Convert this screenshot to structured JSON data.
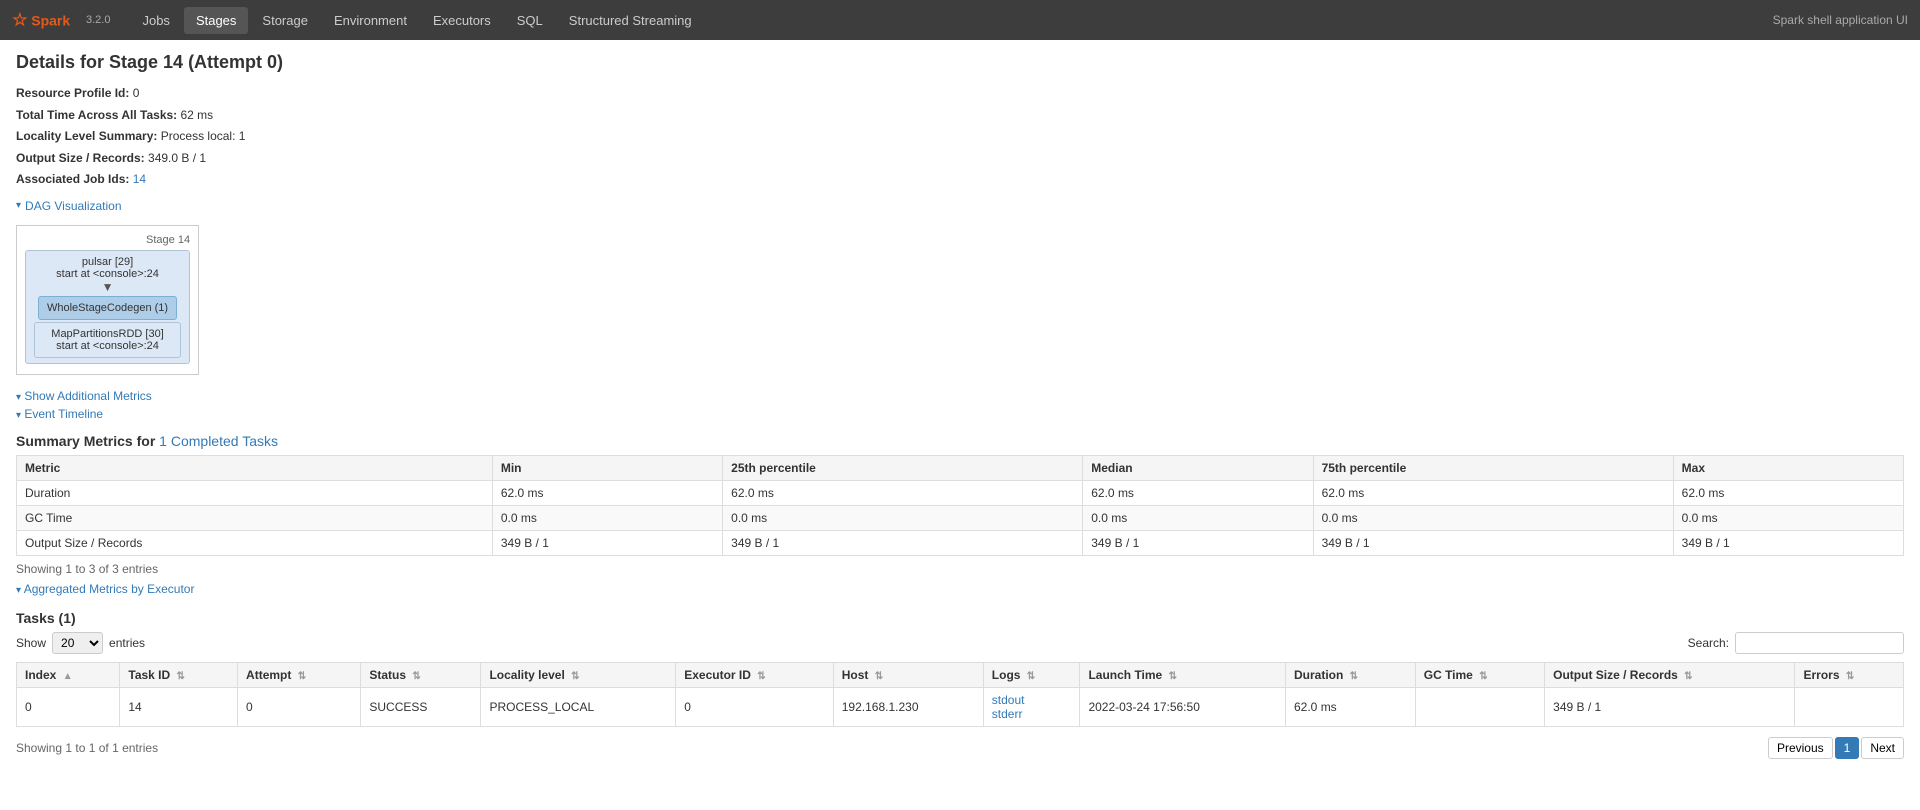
{
  "app": {
    "version": "3.2.0",
    "title": "Spark shell application UI"
  },
  "nav": {
    "items": [
      {
        "label": "Jobs",
        "href": "#",
        "active": false
      },
      {
        "label": "Stages",
        "href": "#",
        "active": true
      },
      {
        "label": "Storage",
        "href": "#",
        "active": false
      },
      {
        "label": "Environment",
        "href": "#",
        "active": false
      },
      {
        "label": "Executors",
        "href": "#",
        "active": false
      },
      {
        "label": "SQL",
        "href": "#",
        "active": false
      },
      {
        "label": "Structured Streaming",
        "href": "#",
        "active": false
      }
    ]
  },
  "page": {
    "title": "Details for Stage 14 (Attempt 0)",
    "resource_profile_id": "0",
    "total_time": "62 ms",
    "locality_level_summary": "Process local: 1",
    "output_size_records": "349.0 B / 1",
    "associated_job_ids": "14"
  },
  "dag": {
    "toggle_label": "DAG Visualization",
    "stage_label": "Stage 14",
    "outer_node_line1": "pulsar [29]",
    "outer_node_line2": "start at <console>:24",
    "inner_node": "WholeStageCodegen (1)",
    "sub_node_line1": "MapPartitionsRDD [30]",
    "sub_node_line2": "start at <console>:24"
  },
  "show_additional_metrics": "Show Additional Metrics",
  "event_timeline": "Event Timeline",
  "summary": {
    "header_prefix": "Summary Metrics for ",
    "completed_tasks_link": "1 Completed Tasks",
    "columns": [
      "Metric",
      "Min",
      "25th percentile",
      "Median",
      "75th percentile",
      "Max"
    ],
    "rows": [
      {
        "metric": "Duration",
        "min": "62.0 ms",
        "p25": "62.0 ms",
        "median": "62.0 ms",
        "p75": "62.0 ms",
        "max": "62.0 ms"
      },
      {
        "metric": "GC Time",
        "min": "0.0 ms",
        "p25": "0.0 ms",
        "median": "0.0 ms",
        "p75": "0.0 ms",
        "max": "0.0 ms"
      },
      {
        "metric": "Output Size / Records",
        "min": "349 B / 1",
        "p25": "349 B / 1",
        "median": "349 B / 1",
        "p75": "349 B / 1",
        "max": "349 B / 1"
      }
    ],
    "showing_text": "Showing 1 to 3 of 3 entries"
  },
  "aggregated_metrics": {
    "label": "Aggregated Metrics by Executor"
  },
  "tasks": {
    "header": "Tasks (1)",
    "show_label": "Show",
    "entries_label": "entries",
    "show_value": "20",
    "search_label": "Search:",
    "columns": [
      "Index",
      "Task ID",
      "Attempt",
      "Status",
      "Locality level",
      "Executor ID",
      "Host",
      "Logs",
      "Launch Time",
      "Duration",
      "GC Time",
      "Output Size / Records",
      "Errors"
    ],
    "rows": [
      {
        "index": "0",
        "task_id": "14",
        "attempt": "0",
        "status": "SUCCESS",
        "locality_level": "PROCESS_LOCAL",
        "executor_id": "0",
        "host": "192.168.1.230",
        "log_stdout": "stdout",
        "log_stderr": "stderr",
        "launch_time": "2022-03-24 17:56:50",
        "duration": "62.0 ms",
        "gc_time": "",
        "output_size": "349 B / 1",
        "errors": ""
      }
    ],
    "showing_text": "Showing 1 to 1 of 1 entries"
  },
  "pagination": {
    "previous_label": "Previous",
    "next_label": "Next",
    "current_page": "1"
  }
}
